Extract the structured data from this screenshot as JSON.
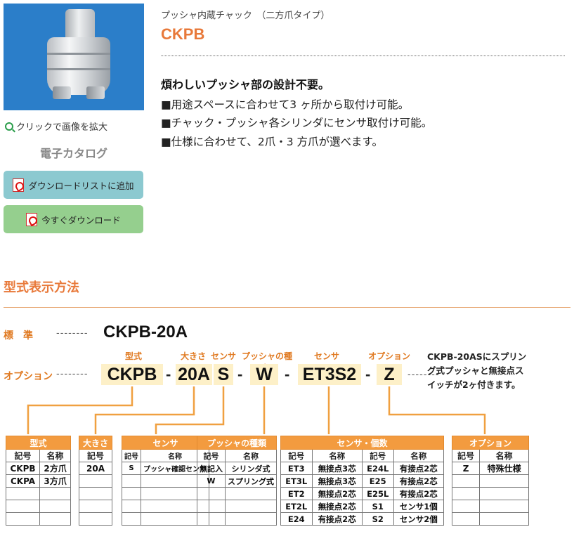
{
  "sidebar": {
    "zoom_label": "クリックで画像を拡大",
    "catalog_heading": "電子カタログ",
    "download_add_label": "ダウンロードリストに追加",
    "download_now_label": "今すぐダウンロード"
  },
  "product": {
    "subtitle": "プッシャ内蔵チャック　（二方爪タイプ）",
    "title": "CKPB",
    "lead": "煩わしいプッシャ部の設計不要。",
    "features": [
      "■用途スペースに合わせて3 ヶ所から取付け可能。",
      "■チャック・プッシャ各シリンダにセンサ取付け可能。",
      "■仕様に合わせて、2爪・3 方爪が選べます。"
    ]
  },
  "model_section": {
    "title": "型式表示方法",
    "standard_label": "標　準",
    "standard_code": "CKPB-20A",
    "option_label": "オプション",
    "dashes": "--------",
    "part_labels": [
      "型式",
      "大きさ",
      "センサ",
      "プッシャの種類",
      "センサ",
      "オプション"
    ],
    "segments": [
      "CKPB",
      "20A",
      "S",
      "W",
      "ET3S2",
      "Z"
    ],
    "hyphen": "-",
    "note_lines": [
      "CKPB-20ASにスプリン",
      "グ式プッシャと無接点ス",
      "イッチが2ヶ付きます。"
    ]
  },
  "tables": {
    "col_code": "記号",
    "col_name": "名称",
    "type": {
      "title": "型式",
      "rows": [
        [
          "CKPB",
          "2方爪"
        ],
        [
          "CKPA",
          "3方爪"
        ],
        [
          "",
          ""
        ],
        [
          "",
          ""
        ],
        [
          "",
          ""
        ]
      ]
    },
    "size": {
      "title": "大きさ",
      "rows": [
        "20A",
        "",
        "",
        "",
        ""
      ]
    },
    "sensor": {
      "title": "センサ",
      "rows": [
        [
          "S",
          "プッシャ確認センサ"
        ],
        [
          "",
          ""
        ],
        [
          "",
          ""
        ],
        [
          "",
          ""
        ],
        [
          "",
          ""
        ]
      ]
    },
    "pusher": {
      "title": "プッシャの種類",
      "rows": [
        [
          "無記入",
          "シリンダ式"
        ],
        [
          "W",
          "スプリング式"
        ],
        [
          "",
          ""
        ],
        [
          "",
          ""
        ],
        [
          "",
          ""
        ]
      ]
    },
    "sensor_qty": {
      "title": "センサ・個数",
      "rows": [
        [
          "ET3",
          "無接点3芯",
          "E24L",
          "有接点2芯"
        ],
        [
          "ET3L",
          "無接点3芯",
          "E25",
          "有接点2芯"
        ],
        [
          "ET2",
          "無接点2芯",
          "E25L",
          "有接点2芯"
        ],
        [
          "ET2L",
          "無接点2芯",
          "S1",
          "センサ1個"
        ],
        [
          "E24",
          "有接点2芯",
          "S2",
          "センサ2個"
        ]
      ]
    },
    "option": {
      "title": "オプション",
      "rows": [
        [
          "Z",
          "特殊仕様"
        ],
        [
          "",
          ""
        ],
        [
          "",
          ""
        ],
        [
          "",
          ""
        ],
        [
          "",
          ""
        ]
      ]
    }
  },
  "colors": {
    "accent": "#e8793a",
    "table_header": "#f39b3f",
    "segment_bg": "#fdf0c8",
    "photo_bg": "#2b7ec9"
  }
}
